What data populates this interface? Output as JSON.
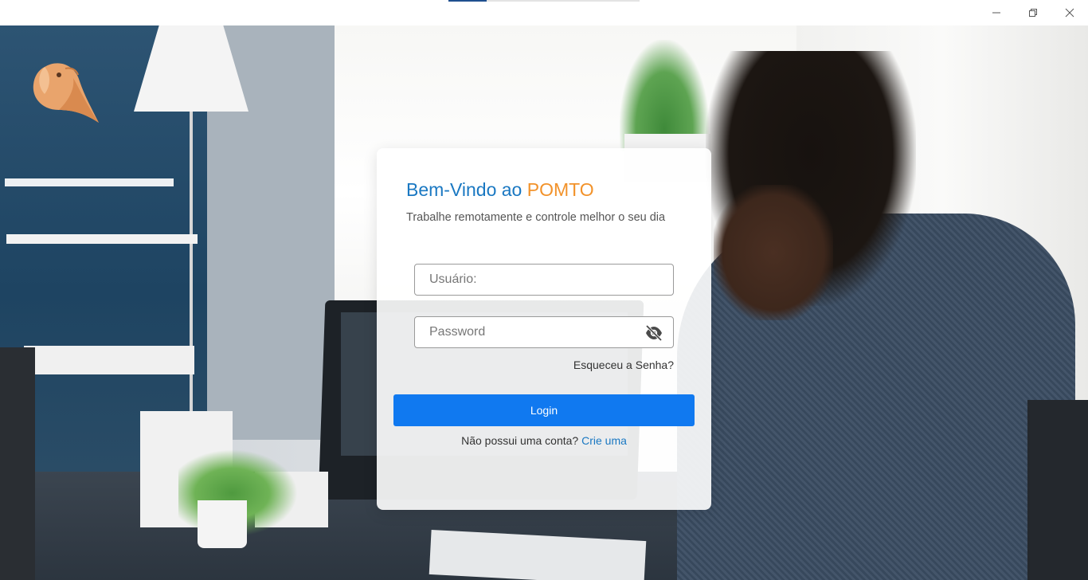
{
  "window": {
    "load_progress": 0.2,
    "controls": {
      "minimize_icon": "minimize-icon",
      "maximize_icon": "restore-icon",
      "close_icon": "close-icon"
    }
  },
  "app": {
    "logo_icon": "bird-logo-icon"
  },
  "login": {
    "title_prefix": "Bem-Vindo ao",
    "title_brand": "POMTO",
    "subtitle": "Trabalhe remotamente e controle melhor o seu dia",
    "username_placeholder": "Usuário:",
    "username_value": "",
    "password_placeholder": "Password",
    "password_value": "",
    "password_toggle_icon": "eye-off-icon",
    "forgot_label": "Esqueceu a Senha?",
    "login_label": "Login",
    "signup_text": "Não possui uma conta?",
    "signup_link": "Crie uma"
  },
  "colors": {
    "title_blue": "#1a78c2",
    "brand_orange": "#f2922a",
    "button_blue": "#1079f0",
    "link_blue": "#1a78c2"
  }
}
